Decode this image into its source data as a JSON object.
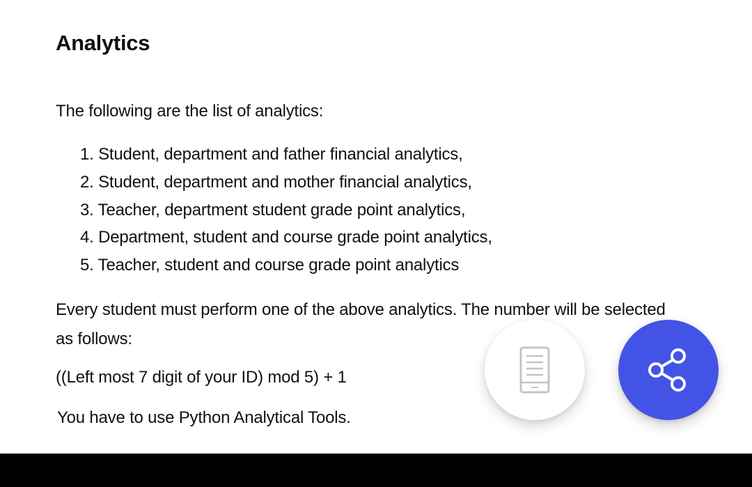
{
  "document": {
    "title": "Analytics",
    "intro": "The following are the list of analytics:",
    "list_items": [
      "1. Student, department and father financial analytics,",
      "2. Student, department and mother financial analytics,",
      "3. Teacher, department student grade point analytics,",
      "4.  Department, student and course grade point analytics,",
      "5. Teacher, student and course grade point analytics"
    ],
    "paragraph": "Every student must perform one of the above analytics. The number will be selected as follows:",
    "formula": "((Left most 7 digit of your ID) mod 5) + 1",
    "note": "You have to use Python Analytical Tools."
  },
  "actions": {
    "reader_button": {
      "icon": "reader-mode-icon"
    },
    "share_button": {
      "icon": "share-icon",
      "color": "#4353e6"
    }
  }
}
